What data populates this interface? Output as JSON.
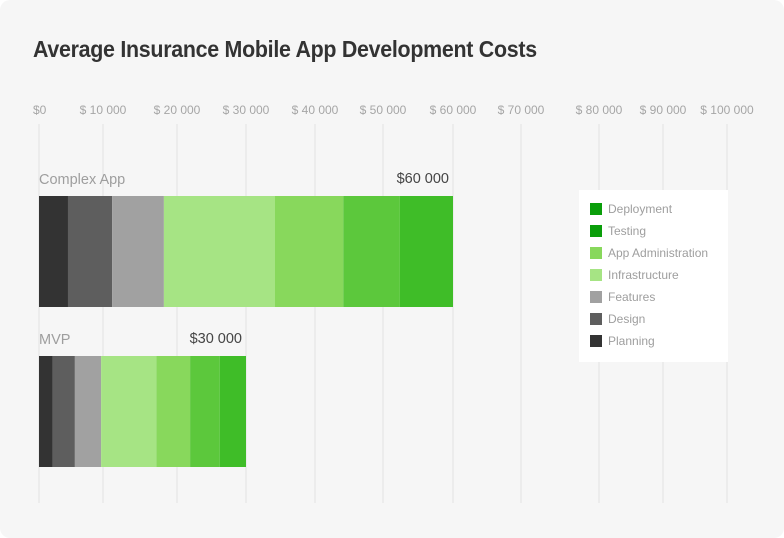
{
  "chart_data": {
    "type": "bar",
    "orientation": "horizontal",
    "stacked": true,
    "title": "Average Insurance Mobile App Development Costs",
    "xlabel": "",
    "ylabel": "",
    "xlim": [
      0,
      100000
    ],
    "grid": true,
    "legend_position": "right",
    "x_ticks": [
      {
        "value": 0,
        "label": "$0"
      },
      {
        "value": 10000,
        "label": "$ 10 000"
      },
      {
        "value": 20000,
        "label": "$ 20 000"
      },
      {
        "value": 30000,
        "label": "$ 30 000"
      },
      {
        "value": 40000,
        "label": "$ 40 000"
      },
      {
        "value": 50000,
        "label": "$ 50 000"
      },
      {
        "value": 60000,
        "label": "$ 60 000"
      },
      {
        "value": 70000,
        "label": "$ 70 000"
      },
      {
        "value": 80000,
        "label": "$ 80 000"
      },
      {
        "value": 90000,
        "label": "$ 90 000"
      },
      {
        "value": 100000,
        "label": "$ 100 000"
      }
    ],
    "categories": [
      "Complex App",
      "MVP"
    ],
    "totals": [
      {
        "value": 60000,
        "label": "$60 000"
      },
      {
        "value": 30000,
        "label": "$30 000"
      }
    ],
    "series": [
      {
        "name": "Planning",
        "color": "#333333",
        "values": [
          4200,
          2000
        ]
      },
      {
        "name": "Design",
        "color": "#5e5e5e",
        "values": [
          6400,
          3200
        ]
      },
      {
        "name": "Features",
        "color": "#a1a1a1",
        "values": [
          7500,
          3800
        ]
      },
      {
        "name": "Infrastructure",
        "color": "#a6e484",
        "values": [
          16100,
          8000
        ]
      },
      {
        "name": "App Administration",
        "color": "#88d85c",
        "values": [
          9900,
          4900
        ]
      },
      {
        "name": "Testing",
        "color": "#5cc83c",
        "values": [
          8200,
          4300
        ]
      },
      {
        "name": "Deployment",
        "color": "#3fbd28",
        "values": [
          7700,
          3800
        ]
      }
    ]
  },
  "legend": {
    "items": [
      {
        "label": "Deployment",
        "color": "#0a9e0a"
      },
      {
        "label": "Testing",
        "color": "#0a9e0a"
      },
      {
        "label": "App Administration",
        "color": "#88d85c"
      },
      {
        "label": "Infrastructure",
        "color": "#a6e484"
      },
      {
        "label": "Features",
        "color": "#a1a1a1"
      },
      {
        "label": "Design",
        "color": "#5e5e5e"
      },
      {
        "label": "Planning",
        "color": "#333333"
      }
    ]
  }
}
